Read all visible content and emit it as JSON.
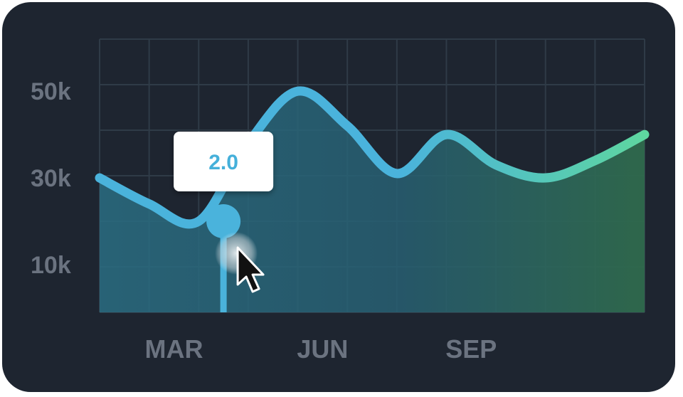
{
  "chart_data": {
    "type": "area",
    "x_ticks": [
      "MAR",
      "JUN",
      "SEP"
    ],
    "y_ticks": [
      {
        "value": 50000,
        "label": "50k"
      },
      {
        "value": 30000,
        "label": "30k"
      },
      {
        "value": 10000,
        "label": "10k"
      }
    ],
    "series": [
      {
        "x": [
          0,
          1,
          2,
          3,
          4,
          5,
          6,
          7,
          8,
          9,
          10,
          11
        ],
        "values": [
          30000,
          24000,
          20000,
          38000,
          50000,
          42000,
          31000,
          40000,
          33000,
          30000,
          34000,
          40000
        ]
      }
    ],
    "ylim": [
      -1000,
      62000
    ],
    "grid": true,
    "tooltip": {
      "x": 2.5,
      "value": 20000,
      "label": "2.0"
    },
    "colors": {
      "background": "#1e2530",
      "grid": "#2f3b47",
      "line_start": "#4ab3dc",
      "line_end": "#5ed6a0",
      "tick": "#6b7380",
      "tooltip_bg": "#ffffff",
      "tooltip_text": "#45b0da"
    },
    "cursor": "arrow-cursor-icon"
  }
}
